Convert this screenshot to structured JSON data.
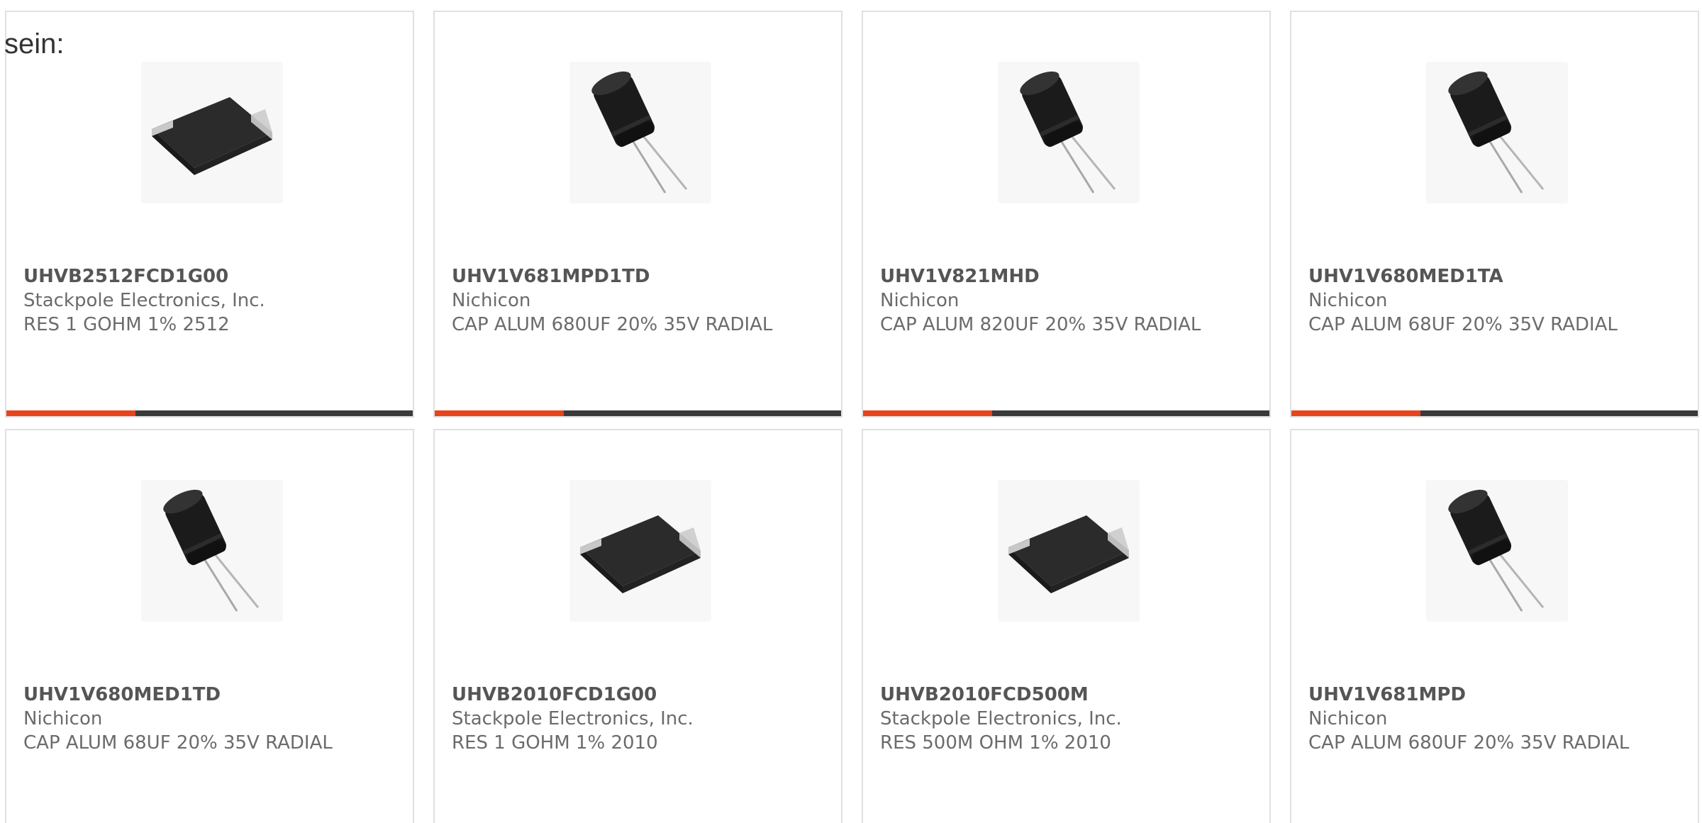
{
  "lead_text": "sein:",
  "accent_color": "#e8431c",
  "bar_color": "#3a3a3a",
  "products": [
    {
      "part_number": "UHVB2512FCD1G00",
      "manufacturer": "Stackpole Electronics, Inc.",
      "description": "RES 1 GOHM 1% 2512",
      "image_icon": "chip-resistor-image",
      "has_bar": true
    },
    {
      "part_number": "UHV1V681MPD1TD",
      "manufacturer": "Nichicon",
      "description": "CAP ALUM 680UF 20% 35V RADIAL",
      "image_icon": "electrolytic-capacitor-image",
      "has_bar": true
    },
    {
      "part_number": "UHV1V821MHD",
      "manufacturer": "Nichicon",
      "description": "CAP ALUM 820UF 20% 35V RADIAL",
      "image_icon": "electrolytic-capacitor-image",
      "has_bar": true
    },
    {
      "part_number": "UHV1V680MED1TA",
      "manufacturer": "Nichicon",
      "description": "CAP ALUM 68UF 20% 35V RADIAL",
      "image_icon": "electrolytic-capacitor-image",
      "has_bar": true
    },
    {
      "part_number": "UHV1V680MED1TD",
      "manufacturer": "Nichicon",
      "description": "CAP ALUM 68UF 20% 35V RADIAL",
      "image_icon": "electrolytic-capacitor-image",
      "has_bar": false
    },
    {
      "part_number": "UHVB2010FCD1G00",
      "manufacturer": "Stackpole Electronics, Inc.",
      "description": "RES 1 GOHM 1% 2010",
      "image_icon": "chip-resistor-image",
      "has_bar": false
    },
    {
      "part_number": "UHVB2010FCD500M",
      "manufacturer": "Stackpole Electronics, Inc.",
      "description": "RES 500M OHM 1% 2010",
      "image_icon": "chip-resistor-image",
      "has_bar": false
    },
    {
      "part_number": "UHV1V681MPD",
      "manufacturer": "Nichicon",
      "description": "CAP ALUM 680UF 20% 35V RADIAL",
      "image_icon": "electrolytic-capacitor-image",
      "has_bar": false
    }
  ]
}
